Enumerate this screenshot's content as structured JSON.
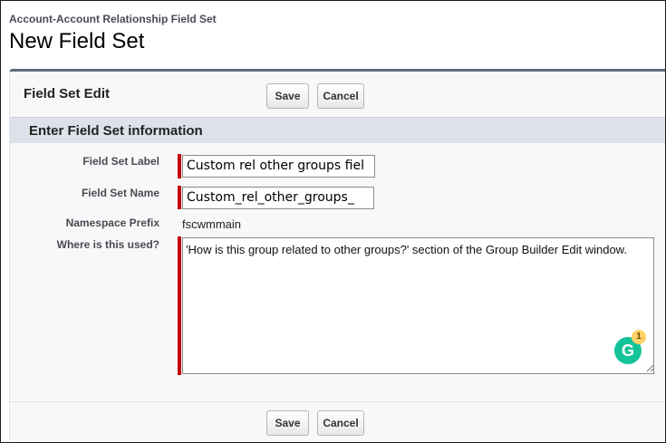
{
  "header": {
    "breadcrumb": "Account-Account Relationship Field Set",
    "title": "New Field Set"
  },
  "panel": {
    "title": "Field Set Edit",
    "save_label": "Save",
    "cancel_label": "Cancel"
  },
  "section": {
    "title": "Enter Field Set information"
  },
  "form": {
    "field_set_label": {
      "label": "Field Set Label",
      "value": "Custom rel other groups fiel"
    },
    "field_set_name": {
      "label": "Field Set Name",
      "value": "Custom_rel_other_groups_"
    },
    "namespace_prefix": {
      "label": "Namespace Prefix",
      "value": "fscwmmain"
    },
    "where_used": {
      "label": "Where is this used?",
      "value": "'How is this group related to other groups?' section of the Group Builder Edit window."
    }
  },
  "grammarly": {
    "icon": "grammarly-icon",
    "letter": "G",
    "badge_count": "1"
  },
  "footer": {
    "save_label": "Save",
    "cancel_label": "Cancel"
  },
  "colors": {
    "required_bar": "#c00000",
    "section_background": "#dde2ea",
    "panel_top_border": "#5a6b7c",
    "grammarly_green": "#15c39a"
  }
}
